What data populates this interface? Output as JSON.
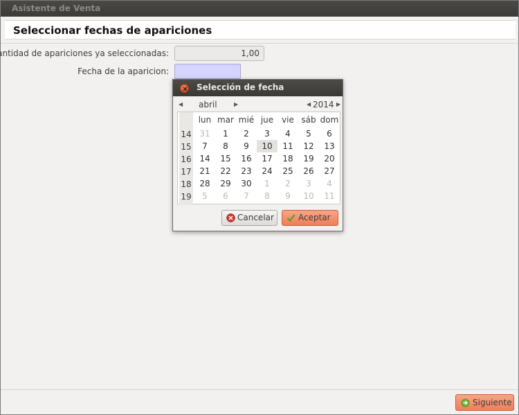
{
  "window": {
    "title": "Asistente de Venta"
  },
  "header": {
    "title": "Seleccionar fechas de apariciones"
  },
  "form": {
    "count_label": "Cantidad de apariciones ya seleccionadas:",
    "count_value": "1,00",
    "date_label": "Fecha de la aparicion:",
    "date_value": ""
  },
  "dialog": {
    "title": "Selección de fecha",
    "month": "abril",
    "year": "2014",
    "day_names": [
      "lun",
      "mar",
      "mié",
      "jue",
      "vie",
      "sáb",
      "dom"
    ],
    "week_numbers": [
      "14",
      "15",
      "16",
      "17",
      "18",
      "19"
    ],
    "weeks": [
      [
        {
          "d": "31",
          "o": true
        },
        {
          "d": "1"
        },
        {
          "d": "2"
        },
        {
          "d": "3"
        },
        {
          "d": "4"
        },
        {
          "d": "5"
        },
        {
          "d": "6"
        }
      ],
      [
        {
          "d": "7"
        },
        {
          "d": "8"
        },
        {
          "d": "9"
        },
        {
          "d": "10",
          "s": true
        },
        {
          "d": "11"
        },
        {
          "d": "12"
        },
        {
          "d": "13"
        }
      ],
      [
        {
          "d": "14"
        },
        {
          "d": "15"
        },
        {
          "d": "16"
        },
        {
          "d": "17"
        },
        {
          "d": "18"
        },
        {
          "d": "19"
        },
        {
          "d": "20"
        }
      ],
      [
        {
          "d": "21"
        },
        {
          "d": "22"
        },
        {
          "d": "23"
        },
        {
          "d": "24"
        },
        {
          "d": "25"
        },
        {
          "d": "26"
        },
        {
          "d": "27"
        }
      ],
      [
        {
          "d": "28"
        },
        {
          "d": "29"
        },
        {
          "d": "30"
        },
        {
          "d": "1",
          "o": true
        },
        {
          "d": "2",
          "o": true
        },
        {
          "d": "3",
          "o": true
        },
        {
          "d": "4",
          "o": true
        }
      ],
      [
        {
          "d": "5",
          "o": true
        },
        {
          "d": "6",
          "o": true
        },
        {
          "d": "7",
          "o": true
        },
        {
          "d": "8",
          "o": true
        },
        {
          "d": "9",
          "o": true
        },
        {
          "d": "10",
          "o": true
        },
        {
          "d": "11",
          "o": true
        }
      ]
    ],
    "cancel_label": "Cancelar",
    "accept_label": "Aceptar"
  },
  "footer": {
    "next_label": "Siguiente"
  },
  "colors": {
    "accent": "#ef7f58",
    "date_field_bg": "#d4d4ff",
    "titlebar": "#3c3b37"
  },
  "icons": {
    "close": "close-icon",
    "calendar": "calendar-icon",
    "cancel": "cancel-icon",
    "accept": "checkmark-icon",
    "next": "arrow-right-icon"
  }
}
